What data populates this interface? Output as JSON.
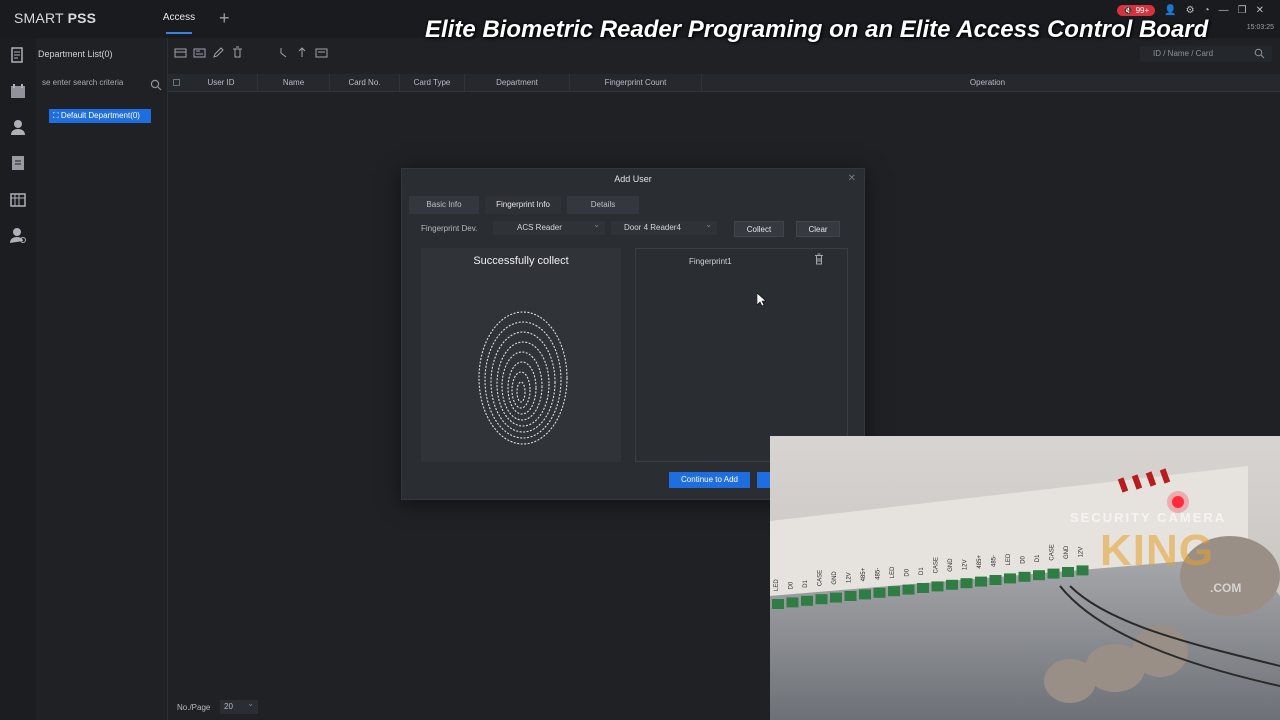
{
  "app": {
    "brand_light": "SMART ",
    "brand_bold": "PSS",
    "tab": "Access",
    "new_tab_icon": "plus-icon"
  },
  "overlay": {
    "title": "Elite Biometric Reader Programing on an Elite Access Control Board"
  },
  "window": {
    "volume_badge": "99+",
    "clock": "15:03:25"
  },
  "sidebar": {
    "title": "Department List(0)",
    "search_placeholder": "se enter search criteria",
    "department": "Default Department(0)"
  },
  "toolbar": {
    "id_search_placeholder": "ID / Name / Card"
  },
  "table": {
    "columns": [
      "User ID",
      "Name",
      "Card No.",
      "Card Type",
      "Department",
      "Fingerprint Count",
      "Operation"
    ]
  },
  "footer": {
    "per_page_label": "No./Page",
    "per_page_value": "20"
  },
  "modal": {
    "title": "Add User",
    "tabs": [
      "Basic Info",
      "Fingerprint Info",
      "Details"
    ],
    "active_tab": "Fingerprint Info",
    "field_label": "Fingerprint Dev.",
    "device": "ACS Reader",
    "reader": "Door 4 Reader4",
    "collect_label": "Collect",
    "clear_label": "Clear",
    "status": "Successfully collect",
    "fingerprint_item": "Fingerprint1",
    "continue_label": "Continue to Add"
  },
  "video": {
    "watermark_top": "SECURITY CAMERA",
    "watermark_main": "KING",
    "watermark_sub": ".COM",
    "terminal_labels": [
      "LED",
      "D0",
      "D1",
      "CASE",
      "GND",
      "12V",
      "485+",
      "485-",
      "LED",
      "D0",
      "D1",
      "CASE",
      "GND",
      "12V",
      "485+",
      "485-",
      "LED",
      "D0",
      "D1",
      "CASE",
      "GND",
      "12V"
    ]
  },
  "colors": {
    "accent": "#1e6ee0",
    "background": "#1f2125",
    "panel": "#2a2d32"
  }
}
